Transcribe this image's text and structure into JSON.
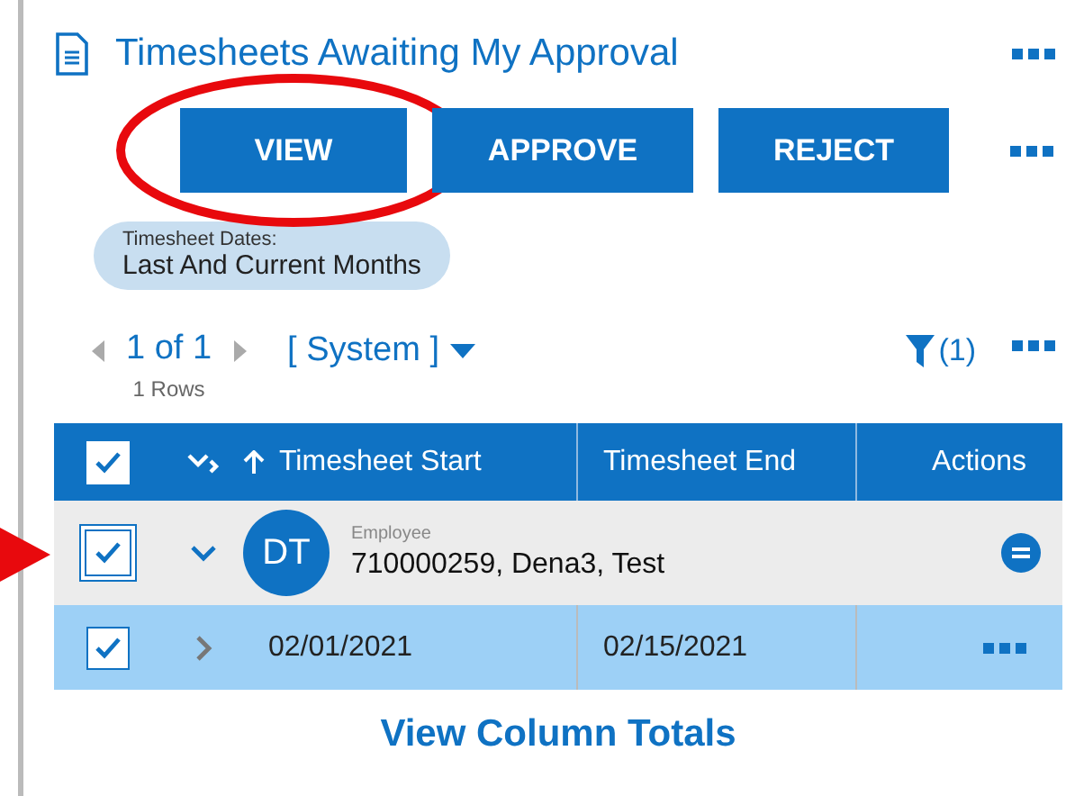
{
  "panel": {
    "title": "Timesheets Awaiting My Approval"
  },
  "buttons": [
    {
      "label": "VIEW",
      "circled": true
    },
    {
      "label": "APPROVE",
      "circled": false
    },
    {
      "label": "REJECT",
      "circled": false
    }
  ],
  "filter_chip": {
    "label": "Timesheet Dates:",
    "value": "Last And Current Months"
  },
  "pager": {
    "page": "1 of 1",
    "rows": "1 Rows",
    "view": "[ System ]",
    "filter_count": "(1)"
  },
  "table": {
    "all_checked": true,
    "columns": [
      {
        "label": "Timesheet Start",
        "sorted": true
      },
      {
        "label": "Timesheet End",
        "sorted": false
      },
      {
        "label": "Actions",
        "sorted": false
      }
    ],
    "groups": [
      {
        "pointed_at": true,
        "checked": true,
        "expanded": true,
        "initials": "DT",
        "caption": "Employee",
        "name": "710000259, Dena3, Test",
        "rows": [
          {
            "checked": true,
            "expanded": false,
            "selected": true,
            "start": "02/01/2021",
            "end": "02/15/2021"
          }
        ]
      }
    ]
  },
  "totals_link": "View Column Totals"
}
